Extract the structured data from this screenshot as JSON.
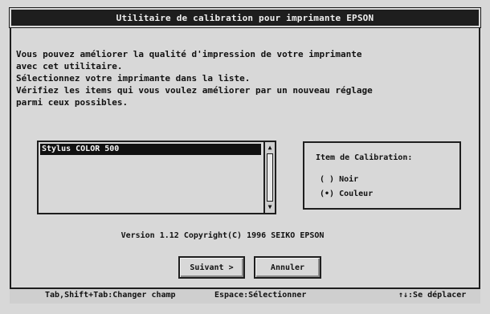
{
  "window": {
    "title": "Utilitaire de calibration pour imprimante EPSON"
  },
  "instructions": [
    "Vous pouvez améliorer la qualité d'impression de votre imprimante",
    "avec cet utilitaire.",
    "Sélectionnez votre imprimante dans la liste.",
    "Vérifiez les items qui vous voulez améliorer par un nouveau réglage",
    "parmi ceux possibles."
  ],
  "printer_list": {
    "items": [
      "Stylus COLOR 500"
    ],
    "selected": "Stylus COLOR 500"
  },
  "calibration_group": {
    "title": "Item de Calibration:",
    "options": [
      {
        "label": "( ) Noir"
      },
      {
        "label": "(•) Couleur"
      }
    ]
  },
  "version_text": "Version 1.12 Copyright(C) 1996 SEIKO EPSON",
  "buttons": {
    "next": "Suivant >",
    "cancel": "Annuler"
  },
  "statusbar": {
    "tab_hint": "Tab,Shift+Tab:Changer champ",
    "space_hint": "Espace:Sélectionner",
    "arrow_hint": "↑↓:Se déplacer"
  },
  "icons": {
    "scroll_up": "scroll-up-arrow-icon",
    "scroll_down": "scroll-down-arrow-icon"
  }
}
